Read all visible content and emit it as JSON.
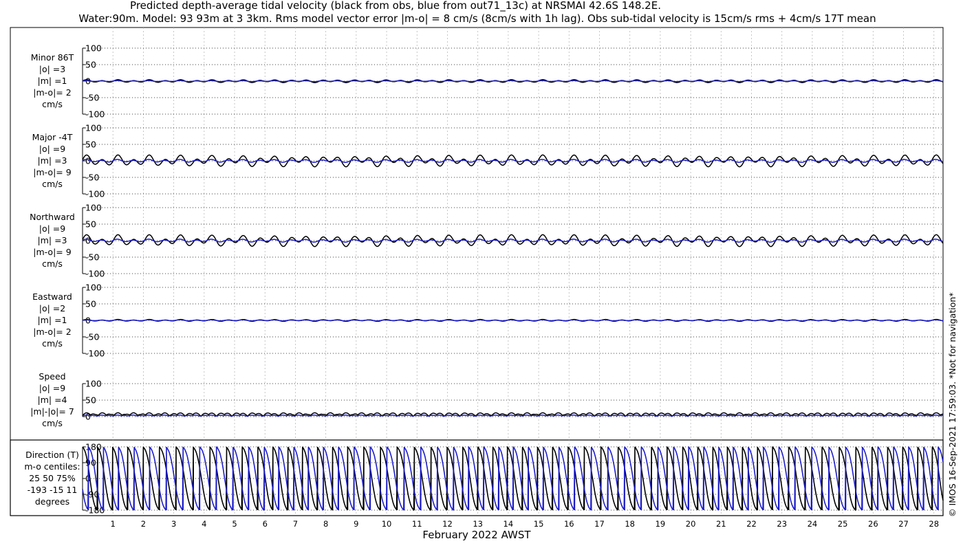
{
  "header": {
    "title_line1": "Predicted depth-average tidal velocity (black from obs, blue from out71_13c) at NRSMAI 42.6S 148.2E.",
    "title_line2": "Water:90m. Model: 93 93m at 3 3km. Rms model vector error |m-o| = 8 cm/s (8cm/s with 1h lag). Obs sub-tidal velocity is 15cm/s rms + 4cm/s 17T mean"
  },
  "side_note": "© IMOS 16-Sep-2021 17:59:03. *Not for navigation*",
  "chart_data": {
    "type": "line",
    "xlabel": "February 2022 AWST",
    "xlim": [
      0,
      28.3
    ],
    "x_ticks": [
      1,
      2,
      3,
      4,
      5,
      6,
      7,
      8,
      9,
      10,
      11,
      12,
      13,
      14,
      15,
      16,
      17,
      18,
      19,
      20,
      21,
      22,
      23,
      24,
      25,
      26,
      27,
      28
    ],
    "colors": {
      "obs": "#000000",
      "model": "#1c1cc8"
    },
    "panels": [
      {
        "id": "minor",
        "labels": [
          "Minor 86T",
          "|o| =3",
          "|m| =1",
          "|m-o|= 2",
          "cm/s"
        ],
        "ylim": [
          -100,
          100
        ],
        "y_ticks": [
          100,
          50,
          0,
          -50,
          -100
        ],
        "y_tick_labels": [
          "100",
          "50",
          "0",
          "-50",
          "-100"
        ],
        "series": [
          {
            "key": "obs",
            "amp_semi": 3,
            "amp_diurnal": 1.5,
            "offset": 0
          },
          {
            "key": "model",
            "amp_semi": 1,
            "amp_diurnal": 0.5,
            "offset": 0
          }
        ]
      },
      {
        "id": "major",
        "labels": [
          "Major -4T",
          "|o| =9",
          "|m| =3",
          "|m-o|= 9",
          "cm/s"
        ],
        "ylim": [
          -100,
          100
        ],
        "y_ticks": [
          100,
          50,
          0,
          -50,
          -100
        ],
        "y_tick_labels": [
          "100",
          "50",
          "0",
          "-50",
          "-100"
        ],
        "series": [
          {
            "key": "obs",
            "amp_semi": 11,
            "amp_diurnal": 7,
            "offset": 0
          },
          {
            "key": "model",
            "amp_semi": 3,
            "amp_diurnal": 1.5,
            "offset": 0
          }
        ]
      },
      {
        "id": "northward",
        "labels": [
          "Northward",
          "|o| =9",
          "|m| =3",
          "|m-o|= 9",
          "cm/s"
        ],
        "ylim": [
          -100,
          100
        ],
        "y_ticks": [
          100,
          50,
          0,
          -50,
          -100
        ],
        "y_tick_labels": [
          "100",
          "50",
          "0",
          "-50",
          "-100"
        ],
        "series": [
          {
            "key": "obs",
            "amp_semi": 11,
            "amp_diurnal": 7,
            "offset": 0
          },
          {
            "key": "model",
            "amp_semi": 3,
            "amp_diurnal": 1.5,
            "offset": 0
          }
        ]
      },
      {
        "id": "eastward",
        "labels": [
          "Eastward",
          "|o| =2",
          "|m| =1",
          "|m-o|= 2",
          "cm/s"
        ],
        "ylim": [
          -100,
          100
        ],
        "y_ticks": [
          100,
          50,
          0,
          -50,
          -100
        ],
        "y_tick_labels": [
          "100",
          "50",
          "0",
          "-50",
          "-100"
        ],
        "series": [
          {
            "key": "obs",
            "amp_semi": 2,
            "amp_diurnal": 1,
            "offset": 0
          },
          {
            "key": "model",
            "amp_semi": 1,
            "amp_diurnal": 0.5,
            "offset": 0
          }
        ]
      },
      {
        "id": "speed",
        "labels": [
          "Speed",
          "|o| =9",
          "|m| =4",
          "|m|-|o|= 7",
          "cm/s"
        ],
        "ylim": [
          0,
          100
        ],
        "y_ticks": [
          100,
          50,
          0
        ],
        "y_tick_labels": [
          "100",
          "50",
          "0"
        ],
        "series": [
          {
            "key": "obs",
            "amp_semi": 8,
            "amp_diurnal": 5,
            "offset": 0
          },
          {
            "key": "model",
            "amp_semi": 3,
            "amp_diurnal": 1.5,
            "offset": 0
          }
        ]
      },
      {
        "id": "direction",
        "labels": [
          "Direction (T)",
          "m-o centiles:",
          "25  50  75%",
          "-193  -15   11",
          "degrees"
        ],
        "ylim": [
          -180,
          180
        ],
        "y_ticks": [
          180,
          90,
          0,
          -90,
          -180
        ],
        "y_tick_labels": [
          "180",
          "90",
          "0",
          "-90",
          "-180"
        ],
        "series": [
          {
            "key": "obs",
            "phase_offset": 0
          },
          {
            "key": "model",
            "phase_offset": 0.6
          }
        ]
      }
    ]
  }
}
